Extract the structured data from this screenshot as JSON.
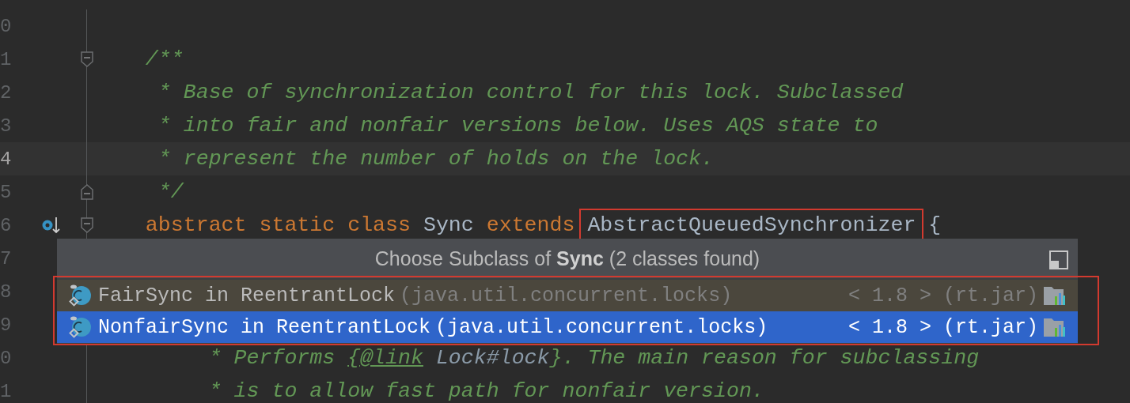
{
  "editor": {
    "lines": [
      {
        "number": "0",
        "current": false
      },
      {
        "number": "1",
        "current": false,
        "fold_start": true,
        "tokens": [
          {
            "kind": "comment",
            "text": "    /**"
          }
        ]
      },
      {
        "number": "2",
        "current": false,
        "tokens": [
          {
            "kind": "comment",
            "text": "     * Base of synchronization control for this lock. Subclassed"
          }
        ]
      },
      {
        "number": "3",
        "current": false,
        "tokens": [
          {
            "kind": "comment",
            "text": "     * into fair and nonfair versions below. Uses AQS state to"
          }
        ]
      },
      {
        "number": "4",
        "current": true,
        "tokens": [
          {
            "kind": "comment",
            "text": "     * represent the number of holds on the lock."
          }
        ]
      },
      {
        "number": "5",
        "current": false,
        "fold_end": true,
        "tokens": [
          {
            "kind": "comment",
            "text": "     */"
          }
        ]
      },
      {
        "number": "6",
        "current": false,
        "implemented": true,
        "fold_start": true,
        "tokens": [
          {
            "kind": "keyword",
            "text": "    abstract static class "
          },
          {
            "kind": "plain",
            "text": "Sync "
          },
          {
            "kind": "keyword",
            "text": "extends "
          },
          {
            "kind": "plain",
            "text": "AbstractQueuedSynchronizer",
            "framed": true
          },
          {
            "kind": "plain",
            "text": " {"
          }
        ]
      },
      {
        "number": "7",
        "current": false
      },
      {
        "number": "8",
        "current": false
      },
      {
        "number": "9",
        "current": false
      },
      {
        "number": "0",
        "current": false,
        "tokens": [
          {
            "kind": "comment",
            "text": "         * Performs "
          },
          {
            "kind": "doc-tag",
            "text": "{@link"
          },
          {
            "kind": "doc-ref",
            "text": " Lock#lock"
          },
          {
            "kind": "comment",
            "text": "}. The main reason for subclassing"
          }
        ]
      },
      {
        "number": "1",
        "current": false,
        "tokens": [
          {
            "kind": "comment",
            "text": "         * is to allow fast path for nonfair version."
          }
        ]
      }
    ]
  },
  "popup": {
    "title": "Choose Subclass of **Sync** (2 classes found)",
    "framed": true,
    "items": [
      {
        "name": "FairSync in ReentrantLock",
        "location": "(java.util.concurrent.locks)",
        "version": "< 1.8 > (rt.jar)",
        "selected": false,
        "hovered": true
      },
      {
        "name": "NonfairSync in ReentrantLock",
        "location": "(java.util.concurrent.locks)",
        "version": "< 1.8 > (rt.jar)",
        "selected": true,
        "hovered": false
      }
    ]
  }
}
